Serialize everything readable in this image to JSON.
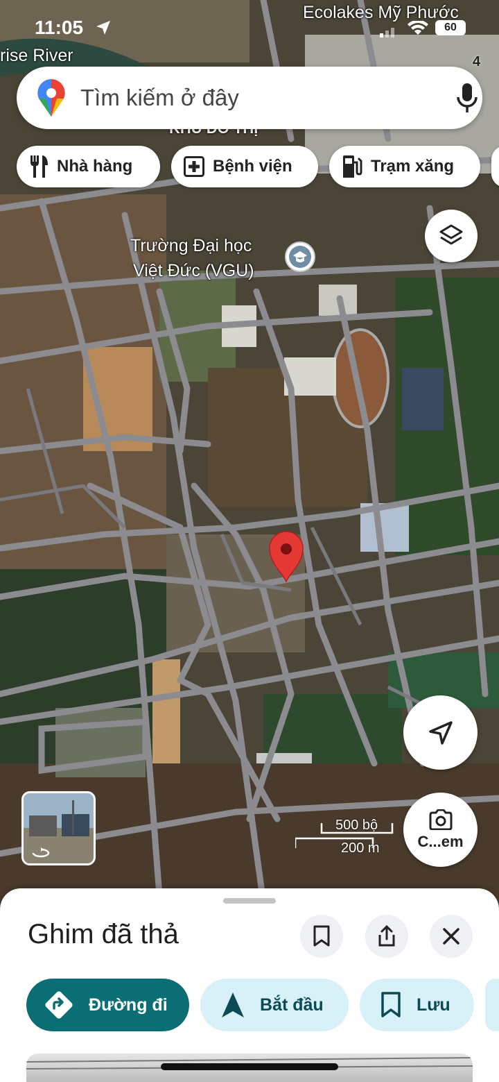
{
  "status_bar": {
    "time": "11:05",
    "battery": "60"
  },
  "map": {
    "labels": {
      "top_right": "Ecolakes Mỹ Phước",
      "river": "rise River",
      "district": "KHU ĐÔ THỊ",
      "road_number": "4",
      "university_line1": "Trường Đại học",
      "university_line2": "Việt Đức (VGU)"
    },
    "scale": {
      "imperial": "500 bộ",
      "metric": "200 m"
    }
  },
  "search": {
    "placeholder": "Tìm kiếm ở đây"
  },
  "chips": [
    {
      "label": "Nhà hàng",
      "icon": "fork-knife-icon"
    },
    {
      "label": "Bệnh viện",
      "icon": "hospital-plus-icon"
    },
    {
      "label": "Trạm xăng",
      "icon": "gas-pump-icon"
    }
  ],
  "lens_button": {
    "label": "C...em"
  },
  "sheet": {
    "title": "Ghim đã thả",
    "actions": [
      {
        "label": "Đường đi",
        "icon": "directions-icon"
      },
      {
        "label": "Bắt đầu",
        "icon": "navigation-arrow-icon"
      },
      {
        "label": "Lưu",
        "icon": "bookmark-icon"
      }
    ]
  },
  "colors": {
    "accent_teal": "#0b6e74",
    "chip_light": "#d8f1f8",
    "pin_red": "#e53935"
  }
}
